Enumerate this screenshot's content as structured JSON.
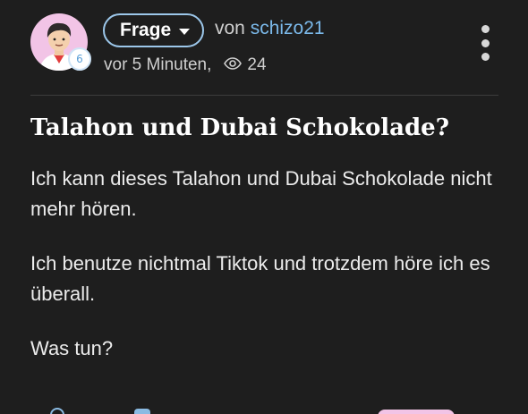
{
  "post": {
    "type_label": "Frage",
    "by_prefix": "von",
    "author": "schizo21",
    "author_level": "6",
    "time_ago": "vor 5 Minuten,",
    "view_count": "24",
    "title": "Talahon und Dubai Schokolade?",
    "body": [
      "Ich kann dieses Talahon und Dubai Schokolade nicht mehr hören.",
      "Ich benutze nichtmal Tiktok und trotzdem höre ich es überall.",
      "Was tun?"
    ]
  },
  "icons": {
    "avatar": "cartoon-avatar",
    "dropdown": "caret-down-icon",
    "views": "eye-icon",
    "menu": "more-vertical-icon"
  },
  "colors": {
    "background": "#1e1e1e",
    "accent": "#7bb9ea",
    "avatar_background": "#f2c4e6"
  }
}
